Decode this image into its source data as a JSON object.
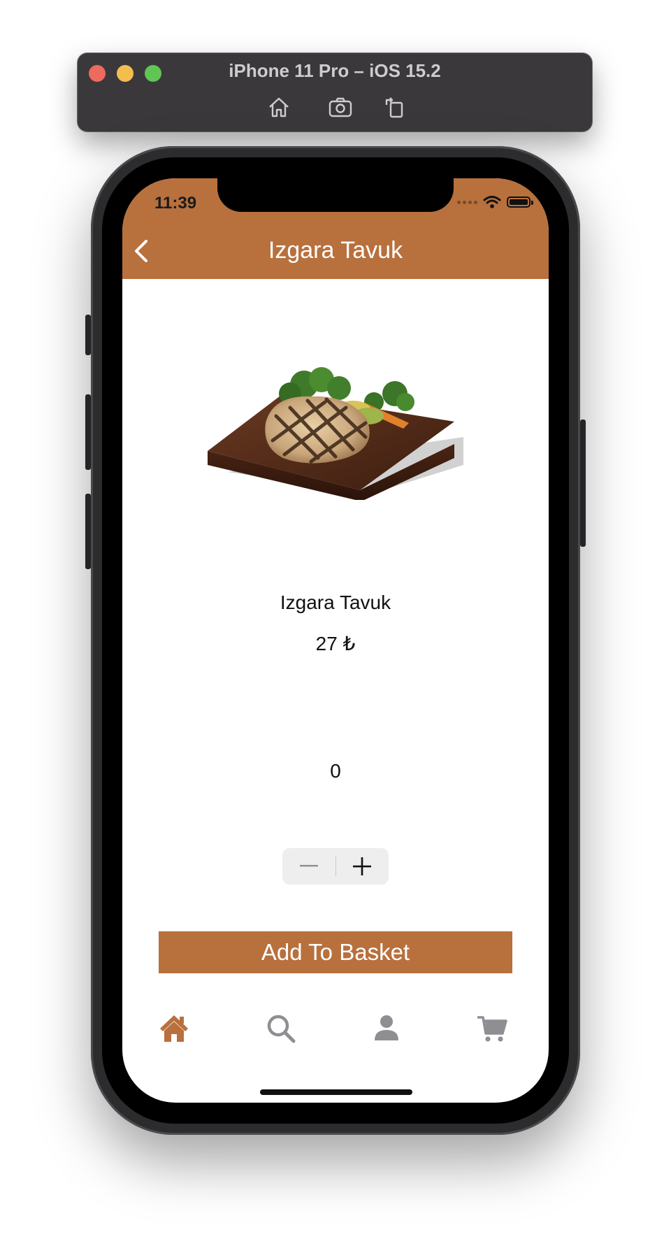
{
  "simulator": {
    "title": "iPhone 11 Pro – iOS 15.2",
    "toolbar": [
      "home-icon",
      "screenshot-icon",
      "rotate-icon"
    ]
  },
  "status_bar": {
    "time": "11:39"
  },
  "nav": {
    "title": "Izgara Tavuk",
    "back_icon": "chevron-left-icon"
  },
  "product": {
    "name": "Izgara Tavuk",
    "price": "27 ₺",
    "quantity": "0",
    "image": "grilled-chicken-on-board"
  },
  "stepper": {
    "decrement_icon": "minus-icon",
    "increment_icon": "plus-icon"
  },
  "actions": {
    "add_to_basket": "Add To Basket"
  },
  "tabbar": {
    "items": [
      {
        "icon": "home-icon",
        "active": true
      },
      {
        "icon": "search-icon",
        "active": false
      },
      {
        "icon": "person-icon",
        "active": false
      },
      {
        "icon": "cart-icon",
        "active": false
      }
    ]
  },
  "colors": {
    "accent": "#b8703d",
    "inactive_icon": "#8e8e93"
  }
}
